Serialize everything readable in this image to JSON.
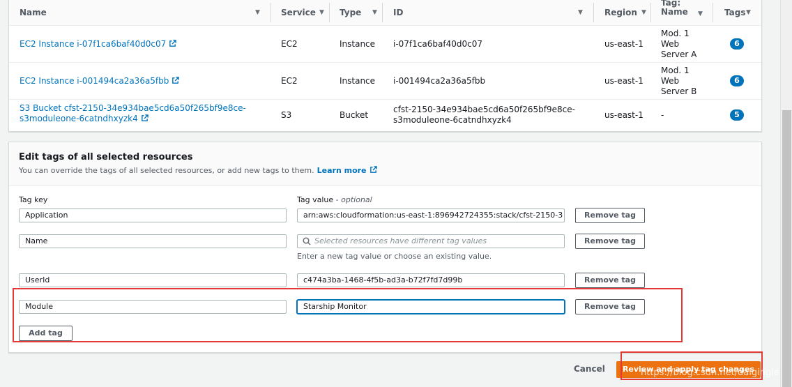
{
  "table": {
    "columns": [
      {
        "label": "Name",
        "sortable": true
      },
      {
        "label": "Service",
        "sortable": true
      },
      {
        "label": "Type",
        "sortable": true
      },
      {
        "label": "ID",
        "sortable": true
      },
      {
        "label": "Region",
        "sortable": true
      },
      {
        "label_line1": "Tag:",
        "label_line2": "Name",
        "sortable": true
      },
      {
        "label": "Tags",
        "sortable": true
      }
    ],
    "rows": [
      {
        "name_line1": "EC2 Instance i-07f1ca6baf40d0c07",
        "name_line2": "",
        "service": "EC2",
        "type": "Instance",
        "id_line1": "i-07f1ca6baf40d0c07",
        "id_line2": "",
        "region": "us-east-1",
        "tag_name_lines": [
          "Mod. 1",
          "Web",
          "Server A"
        ],
        "tags": "6"
      },
      {
        "name_line1": "EC2 Instance i-001494ca2a36a5fbb",
        "name_line2": "",
        "service": "EC2",
        "type": "Instance",
        "id_line1": "i-001494ca2a36a5fbb",
        "id_line2": "",
        "region": "us-east-1",
        "tag_name_lines": [
          "Mod. 1",
          "Web",
          "Server B"
        ],
        "tags": "6"
      },
      {
        "name_line1": "S3 Bucket cfst-2150-34e934bae5cd6a50f265bf9e8ce-",
        "name_line2": "s3moduleone-6catndhxyzk4",
        "service": "S3",
        "type": "Bucket",
        "id_line1": "cfst-2150-34e934bae5cd6a50f265bf9e8ce-",
        "id_line2": "s3moduleone-6catndhxyzk4",
        "region": "us-east-1",
        "tag_name_lines": [
          "-"
        ],
        "tags": "5"
      }
    ]
  },
  "edit_tags": {
    "title": "Edit tags of all selected resources",
    "description": "You can override the tags of all selected resources, or add new tags to them.",
    "learn_more": "Learn more",
    "key_label": "Tag key",
    "value_label": "Tag value",
    "value_optional": "- optional",
    "rows": [
      {
        "key": "Application",
        "value": "arn:aws:cloudformation:us-east-1:896942724355:stack/cfst-2150-3",
        "placeholder": ""
      },
      {
        "key": "Name",
        "value": "",
        "placeholder": "Selected resources have different tag values"
      },
      {
        "key": "UserId",
        "value": "c474a3ba-1468-4f5b-ad3a-b72f7fd7d99b",
        "placeholder": ""
      },
      {
        "key": "Module",
        "value": "Starship Monitor",
        "placeholder": ""
      }
    ],
    "name_hint": "Enter a new tag value or choose an existing value.",
    "remove_label": "Remove tag",
    "add_label": "Add tag"
  },
  "footer": {
    "cancel": "Cancel",
    "submit": "Review and apply tag changes"
  },
  "watermark": "https://blog.csdn.net/daigingle",
  "colors": {
    "link": "#0073bb",
    "primary": "#ec7211",
    "badge": "#0073bb",
    "highlight": "#e53935"
  }
}
